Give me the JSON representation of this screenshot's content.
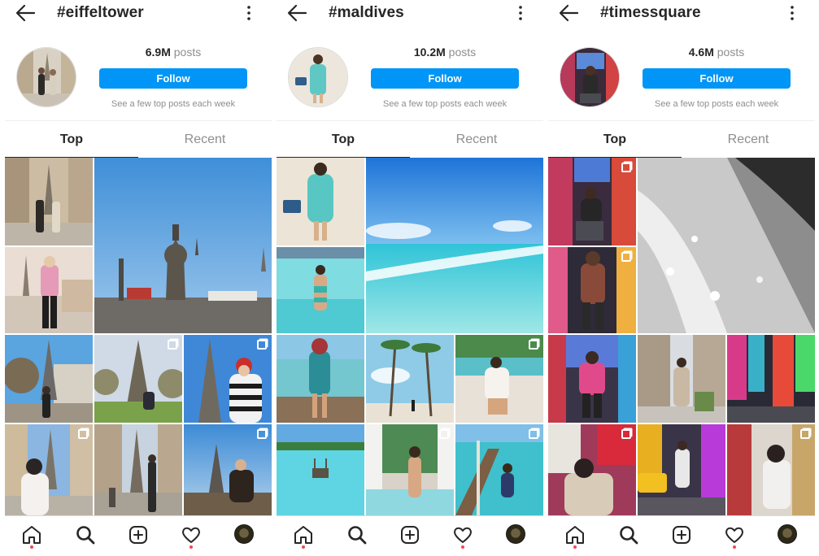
{
  "panels": [
    {
      "hashtag": "#eiffeltower",
      "posts_count": "6.9M",
      "posts_label": "posts",
      "follow_label": "Follow",
      "note": "See a few top posts each week",
      "tabs": {
        "top": "Top",
        "recent": "Recent"
      },
      "active_tab": "Top"
    },
    {
      "hashtag": "#maldives",
      "posts_count": "10.2M",
      "posts_label": "posts",
      "follow_label": "Follow",
      "note": "See a few top posts each week",
      "tabs": {
        "top": "Top",
        "recent": "Recent"
      },
      "active_tab": "Top"
    },
    {
      "hashtag": "#timessquare",
      "posts_count": "4.6M",
      "posts_label": "posts",
      "follow_label": "Follow",
      "note": "See a few top posts each week",
      "tabs": {
        "top": "Top",
        "recent": "Recent"
      },
      "active_tab": "Top"
    }
  ],
  "icons": {
    "back": "back-arrow-icon",
    "more": "more-vertical-icon",
    "multi": "multiple-photos-icon",
    "nav": [
      "home-icon",
      "search-icon",
      "new-post-icon",
      "activity-heart-icon",
      "profile-avatar"
    ]
  },
  "colors": {
    "accent": "#0095f6",
    "text": "#262626",
    "muted": "#8e8e8e",
    "notification_dot": "#ed4956"
  }
}
